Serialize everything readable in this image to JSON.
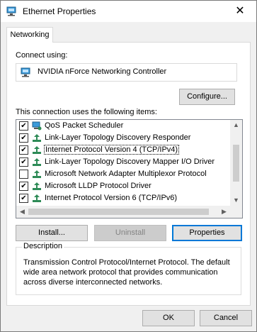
{
  "window": {
    "title": "Ethernet Properties",
    "close_glyph": "✕"
  },
  "tabs": [
    {
      "label": "Networking"
    }
  ],
  "connect_using": {
    "label": "Connect using:",
    "adapter": "NVIDIA nForce Networking Controller",
    "configure_label": "Configure..."
  },
  "items_section": {
    "label": "This connection uses the following items:",
    "items": [
      {
        "label": "QoS Packet Scheduler",
        "checked": true,
        "icon": "qos-icon"
      },
      {
        "label": "Link-Layer Topology Discovery Responder",
        "checked": true,
        "icon": "protocol-icon"
      },
      {
        "label": "Internet Protocol Version 4 (TCP/IPv4)",
        "checked": true,
        "icon": "protocol-icon",
        "selected": true
      },
      {
        "label": "Link-Layer Topology Discovery Mapper I/O Driver",
        "checked": true,
        "icon": "protocol-icon"
      },
      {
        "label": "Microsoft Network Adapter Multiplexor Protocol",
        "checked": false,
        "icon": "protocol-icon"
      },
      {
        "label": "Microsoft LLDP Protocol Driver",
        "checked": true,
        "icon": "protocol-icon"
      },
      {
        "label": "Internet Protocol Version 6 (TCP/IPv6)",
        "checked": true,
        "icon": "protocol-icon"
      }
    ]
  },
  "buttons": {
    "install": "Install...",
    "uninstall": "Uninstall",
    "properties": "Properties"
  },
  "description": {
    "title": "Description",
    "text": "Transmission Control Protocol/Internet Protocol. The default wide area network protocol that provides communication across diverse interconnected networks."
  },
  "footer": {
    "ok": "OK",
    "cancel": "Cancel"
  },
  "colors": {
    "accent": "#0078d7",
    "protocol_icon": "#2e8b57",
    "adapter_icon": "#1e90c8"
  }
}
